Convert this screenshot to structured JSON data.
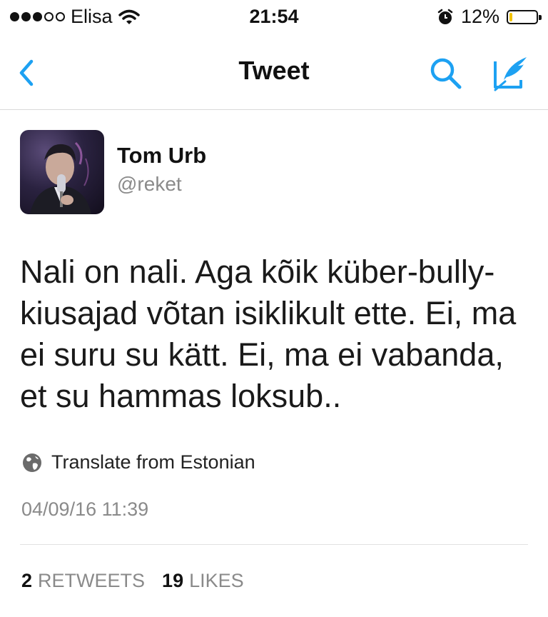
{
  "status_bar": {
    "carrier": "Elisa",
    "signal_dots_filled": 3,
    "signal_dots_total": 5,
    "time": "21:54",
    "battery_percent": "12%",
    "battery_level": 0.12,
    "battery_color": "#f2c300"
  },
  "nav": {
    "title": "Tweet",
    "accent_color": "#1da1f2",
    "icons": [
      "chevron-left-icon",
      "search-icon",
      "compose-tweet-icon"
    ]
  },
  "tweet": {
    "user_name": "Tom Urb",
    "handle": "@reket",
    "lines": [
      "Nali on nali. Aga kõik küber-bully-",
      "kiusajad võtan isiklikult ette. Ei, ma",
      "ei suru su kätt. Ei, ma ei vabanda,",
      "et su hammas loksub.."
    ],
    "translate_label": "Translate from Estonian",
    "timestamp": "04/09/16 11:39",
    "retweets_count": "2",
    "retweets_label": "RETWEETS",
    "likes_count": "19",
    "likes_label": "LIKES"
  }
}
